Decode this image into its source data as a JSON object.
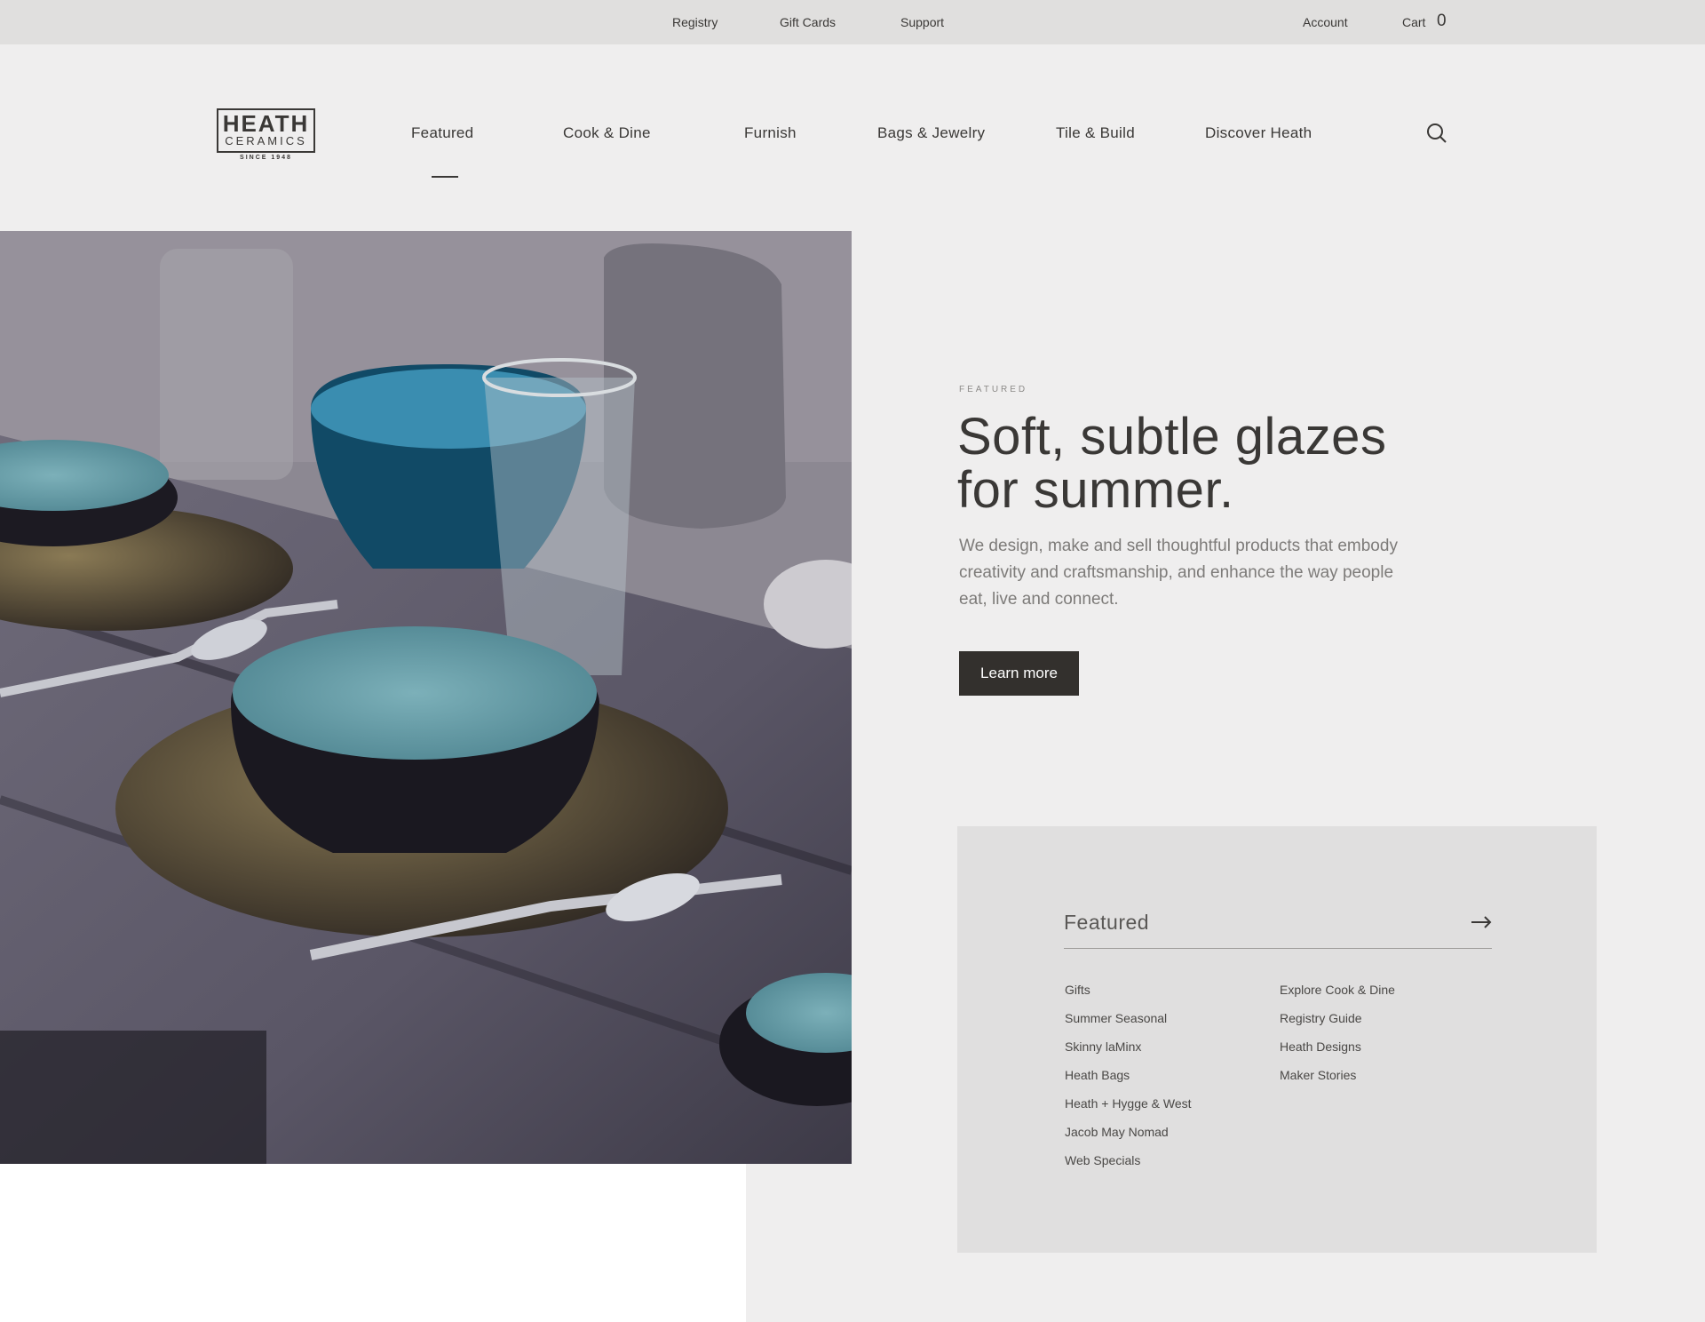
{
  "utility": {
    "links": [
      "Registry",
      "Gift Cards",
      "Support"
    ],
    "account": "Account",
    "cart_label": "Cart",
    "cart_count": "0"
  },
  "logo": {
    "word1": "HEATH",
    "word2": "CERAMICS",
    "since": "SINCE 1948"
  },
  "nav": {
    "items": [
      "Featured",
      "Cook & Dine",
      "Furnish",
      "Bags & Jewelry",
      "Tile & Build",
      "Discover Heath"
    ],
    "active": "Featured"
  },
  "hero": {
    "eyebrow": "FEATURED",
    "headline": "Soft, subtle glazes for summer.",
    "subtext": "We design, make and sell thoughtful products that embody creativity and craftsmanship, and enhance the way people eat, live and connect.",
    "cta": "Learn more"
  },
  "panel": {
    "title": "Featured",
    "col1": [
      "Gifts",
      "Summer Seasonal",
      "Skinny laMinx",
      "Heath Bags",
      "Heath + Hygge & West",
      "Jacob May Nomad",
      "Web Specials"
    ],
    "col2": [
      "Explore Cook & Dine",
      "Registry Guide",
      "Heath Designs",
      "Maker Stories"
    ]
  },
  "colors": {
    "background": "#efeeee",
    "utility_bar": "#e0dfde",
    "button": "#33302d",
    "panel": "#e0dfdf",
    "glaze_teal": "#6fa3ad"
  },
  "icons": [
    "search-icon",
    "arrow-right-icon"
  ]
}
